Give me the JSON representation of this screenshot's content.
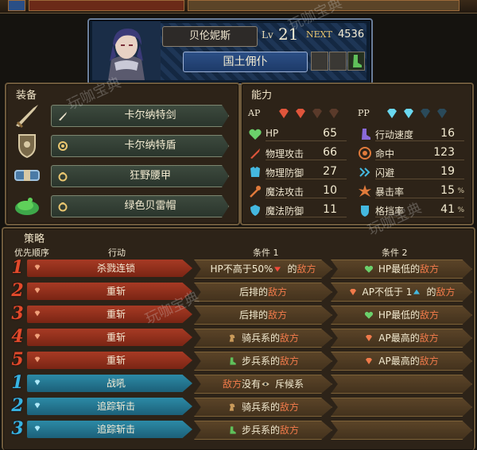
{
  "header": {
    "name": "贝伦妮斯",
    "level_label": "Lv",
    "level": "21",
    "next_label": "NEXT",
    "next_value": "4536",
    "class_name": "国土佣仆"
  },
  "equipment": {
    "title": "装备",
    "items": [
      {
        "name": "卡尔纳特剑",
        "icon": "sword-icon",
        "type_icon": "sword-type-icon"
      },
      {
        "name": "卡尔纳特盾",
        "icon": "shield-icon",
        "type_icon": "ring-type-icon"
      },
      {
        "name": "狂野腰甲",
        "icon": "belt-icon",
        "type_icon": "accessory-type-icon"
      },
      {
        "name": "绿色贝雷帽",
        "icon": "beret-icon",
        "type_icon": "accessory-type-icon"
      }
    ]
  },
  "ability": {
    "title": "能力",
    "ap_label": "AP",
    "pp_label": "PP",
    "ap_filled": 2,
    "ap_total": 4,
    "pp_filled": 2,
    "pp_total": 4,
    "stats_left": [
      {
        "label": "HP",
        "value": "65",
        "icon": "heart-icon",
        "color": "#6bd06b"
      },
      {
        "label": "物理攻击",
        "value": "66",
        "icon": "sword-stat-icon",
        "color": "#e0553b"
      },
      {
        "label": "物理防御",
        "value": "27",
        "icon": "armor-icon",
        "color": "#44b8e0"
      },
      {
        "label": "魔法攻击",
        "value": "10",
        "icon": "wand-icon",
        "color": "#e07a3b"
      },
      {
        "label": "魔法防御",
        "value": "11",
        "icon": "magic-shield-icon",
        "color": "#44b8e0"
      }
    ],
    "stats_right": [
      {
        "label": "行动速度",
        "value": "16",
        "unit": "",
        "icon": "boot-icon",
        "color": "#8a6ad8"
      },
      {
        "label": "命中",
        "value": "123",
        "unit": "",
        "icon": "target-icon",
        "color": "#e07a3b"
      },
      {
        "label": "闪避",
        "value": "19",
        "unit": "",
        "icon": "dodge-icon",
        "color": "#44b8e0"
      },
      {
        "label": "暴击率",
        "value": "15",
        "unit": "%",
        "icon": "burst-icon",
        "color": "#e07a3b"
      },
      {
        "label": "格挡率",
        "value": "41",
        "unit": "%",
        "icon": "block-icon",
        "color": "#44b8e0"
      }
    ]
  },
  "strategy": {
    "title": "策略",
    "col_priority": "优先顺序",
    "col_action": "行动",
    "col_cond1": "条件 1",
    "col_cond2": "条件 2",
    "rows": [
      {
        "num": "1",
        "kind": "red",
        "action": "杀戮连锁",
        "c1": {
          "pre": "HP不高于50%",
          "icon": "down-arrow-icon",
          "mid": "的",
          "red": "敌方",
          "post": ""
        },
        "c2": {
          "pre": "",
          "icon": "heart-icon",
          "mid": "HP最低的",
          "red": "敌方",
          "post": ""
        }
      },
      {
        "num": "2",
        "kind": "red",
        "action": "重斩",
        "c1": {
          "pre": "",
          "icon": "",
          "mid": "后排的",
          "red": "敌方",
          "post": ""
        },
        "c2": {
          "pre": "",
          "icon": "gem-icon",
          "mid": "AP不低于 1",
          "red": "敌方",
          "post": "",
          "icon2": "up-arrow-icon",
          "mid2": "的"
        }
      },
      {
        "num": "3",
        "kind": "red",
        "action": "重斩",
        "c1": {
          "pre": "",
          "icon": "",
          "mid": "后排的",
          "red": "敌方",
          "post": ""
        },
        "c2": {
          "pre": "",
          "icon": "heart-icon",
          "mid": "HP最低的",
          "red": "敌方",
          "post": ""
        }
      },
      {
        "num": "4",
        "kind": "red",
        "action": "重斩",
        "c1": {
          "pre": "",
          "icon": "horse-icon",
          "mid": "骑兵系的",
          "red": "敌方",
          "post": ""
        },
        "c2": {
          "pre": "",
          "icon": "gem-icon",
          "mid": "AP最高的",
          "red": "敌方",
          "post": ""
        }
      },
      {
        "num": "5",
        "kind": "red",
        "action": "重斩",
        "c1": {
          "pre": "",
          "icon": "boot-icon",
          "mid": "步兵系的",
          "red": "敌方",
          "post": ""
        },
        "c2": {
          "pre": "",
          "icon": "gem-icon",
          "mid": "AP最高的",
          "red": "敌方",
          "post": ""
        }
      },
      {
        "num": "1",
        "kind": "blue",
        "action": "战吼",
        "c1": {
          "lead_red": "敌方",
          "mid": "没有",
          "icon": "eye-icon",
          "post": "斥候系"
        },
        "c2": null
      },
      {
        "num": "2",
        "kind": "blue",
        "action": "追踪斩击",
        "c1": {
          "pre": "",
          "icon": "horse-icon",
          "mid": "骑兵系的",
          "red": "敌方",
          "post": ""
        },
        "c2": null
      },
      {
        "num": "3",
        "kind": "blue",
        "action": "追踪斩击",
        "c1": {
          "pre": "",
          "icon": "boot-icon",
          "mid": "步兵系的",
          "red": "敌方",
          "post": ""
        },
        "c2": null
      }
    ]
  },
  "watermark": "玩咖宝典"
}
